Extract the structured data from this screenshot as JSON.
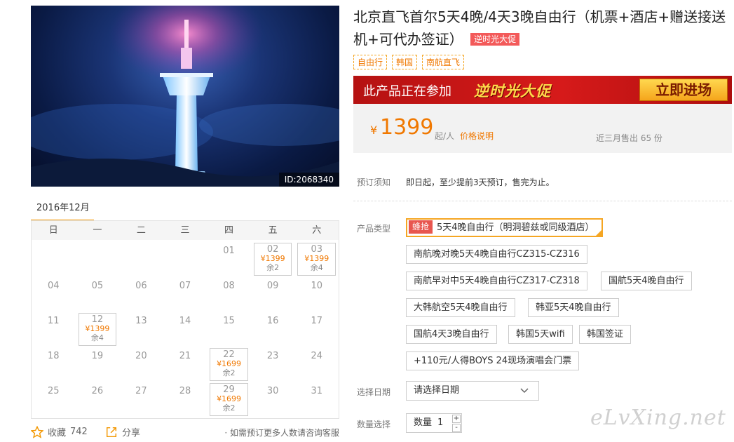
{
  "hero": {
    "image_id": "ID:2068340"
  },
  "calendar": {
    "month_label": "2016年12月",
    "weekdays": [
      "日",
      "一",
      "二",
      "三",
      "四",
      "五",
      "六"
    ],
    "cells": [
      {
        "day": ""
      },
      {
        "day": ""
      },
      {
        "day": ""
      },
      {
        "day": ""
      },
      {
        "day": "01"
      },
      {
        "day": "02",
        "price": "¥1399",
        "remain": "余2"
      },
      {
        "day": "03",
        "price": "¥1399",
        "remain": "余4"
      },
      {
        "day": "04"
      },
      {
        "day": "05"
      },
      {
        "day": "06"
      },
      {
        "day": "07"
      },
      {
        "day": "08"
      },
      {
        "day": "09"
      },
      {
        "day": "10"
      },
      {
        "day": "11"
      },
      {
        "day": "12",
        "price": "¥1399",
        "remain": "余4"
      },
      {
        "day": "13"
      },
      {
        "day": "14"
      },
      {
        "day": "15"
      },
      {
        "day": "16"
      },
      {
        "day": "17"
      },
      {
        "day": "18"
      },
      {
        "day": "19"
      },
      {
        "day": "20"
      },
      {
        "day": "21"
      },
      {
        "day": "22",
        "price": "¥1699",
        "remain": "余2"
      },
      {
        "day": "23"
      },
      {
        "day": "24"
      },
      {
        "day": "25"
      },
      {
        "day": "26"
      },
      {
        "day": "27"
      },
      {
        "day": "28"
      },
      {
        "day": "29",
        "price": "¥1699",
        "remain": "余2"
      },
      {
        "day": "30"
      },
      {
        "day": "31"
      }
    ]
  },
  "actions": {
    "favorite_label": "收藏",
    "favorite_count": "742",
    "share_label": "分享",
    "consult_text": "· 如需预订更多人数请咨询客服"
  },
  "product": {
    "title": "北京直飞首尔5天4晚/4天3晚自由行（机票+酒店+赠送接送机+可代办签证）",
    "promo_badge": "逆时光大促",
    "tags": [
      "自由行",
      "韩国",
      "南航直飞"
    ]
  },
  "banner": {
    "text": "此产品正在参加",
    "brand": "逆时光大促",
    "button": "立即进场"
  },
  "price": {
    "currency": "¥",
    "amount": "1399",
    "unit": "起/人",
    "note": "价格说明",
    "sold": "近三月售出 65 份"
  },
  "booking": {
    "notice_label": "预订须知",
    "notice_text": "即日起，至少提前3天预订，售完为止。",
    "type_label": "产品类型",
    "hot_badge": "蜂抢",
    "options": [
      "5天4晚自由行（明洞碧兹或同级酒店）",
      "南航晚对晚5天4晚自由行CZ315-CZ316",
      "南航早对中5天4晚自由行CZ317-CZ318",
      "国航5天4晚自由行",
      "大韩航空5天4晚自由行",
      "韩亚5天4晚自由行",
      "国航4天3晚自由行",
      "韩国5天wifi",
      "韩国签证",
      "+110元/人得BOYS 24现场演唱会门票"
    ],
    "date_label": "选择日期",
    "date_placeholder": "请选择日期",
    "qty_label": "数量选择",
    "qty_prefix": "数量",
    "qty_value": "1",
    "qty_plus": "+",
    "qty_minus": "-"
  },
  "watermark": "eLvXing.net",
  "colors": {
    "accent": "#f07800",
    "promo_red": "#d61a1a",
    "badge_red": "#f35a5a"
  }
}
